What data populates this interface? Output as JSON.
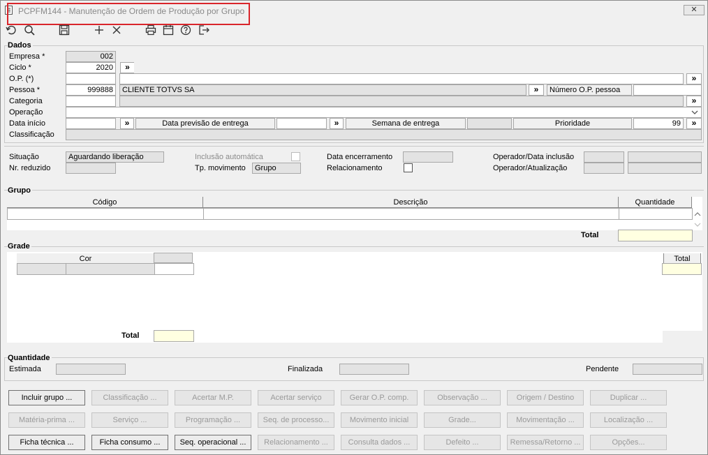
{
  "window": {
    "title": "PCPFM144 - Manutenção de Ordem de Produção por Grupo",
    "close_label": "✕"
  },
  "toolbar": {
    "icons": [
      "undo-icon",
      "search-icon",
      "save-icon",
      "add-icon",
      "delete-icon",
      "print-icon",
      "calendar-icon",
      "help-icon",
      "exit-icon"
    ]
  },
  "dados": {
    "title": "Dados",
    "empresa_label": "Empresa *",
    "empresa_value": "002",
    "ciclo_label": "Ciclo *",
    "ciclo_value": "2020",
    "op_label": "O.P. (*)",
    "op_value": "",
    "pessoa_label": "Pessoa *",
    "pessoa_value": "999888",
    "pessoa_name": "CLIENTE TOTVS SA",
    "numero_op_pessoa_label": "Número O.P. pessoa",
    "numero_op_pessoa_value": "",
    "categoria_label": "Categoria",
    "operacao_label": "Operação",
    "data_inicio_label": "Data início",
    "data_previsao_label": "Data previsão de entrega",
    "semana_label": "Semana de entrega",
    "prioridade_label": "Prioridade",
    "prioridade_value": "99",
    "classificacao_label": "Classificação",
    "search_symbol": "»"
  },
  "status": {
    "situacao_label": "Situação",
    "situacao_value": "Aguardando liberação",
    "nr_reduzido_label": "Nr. reduzido",
    "inclusao_automatica_label": "Inclusão automática",
    "tp_movimento_label": "Tp. movimento",
    "tp_movimento_value": "Grupo",
    "data_encerramento_label": "Data encerramento",
    "relacionamento_label": "Relacionamento",
    "operador_inclusao_label": "Operador/Data inclusão",
    "operador_atualizacao_label": "Operador/Atualização"
  },
  "grupo": {
    "title": "Grupo",
    "columns": [
      "Código",
      "Descrição",
      "Quantidade"
    ],
    "total_label": "Total"
  },
  "grade": {
    "title": "Grade",
    "cor_label": "Cor",
    "total_col_label": "Total",
    "total_label": "Total"
  },
  "quantidade": {
    "title": "Quantidade",
    "estimada_label": "Estimada",
    "finalizada_label": "Finalizada",
    "pendente_label": "Pendente"
  },
  "buttons": {
    "row1": [
      {
        "label": "Incluir grupo ...",
        "enabled": true
      },
      {
        "label": "Classificação ...",
        "enabled": false
      },
      {
        "label": "Acertar M.P.",
        "enabled": false
      },
      {
        "label": "Acertar serviço",
        "enabled": false
      },
      {
        "label": "Gerar O.P. comp.",
        "enabled": false
      },
      {
        "label": "Observação ...",
        "enabled": false
      },
      {
        "label": "Origem / Destino",
        "enabled": false
      },
      {
        "label": "Duplicar ...",
        "enabled": false
      }
    ],
    "row2": [
      {
        "label": "Matéria-prima ...",
        "enabled": false
      },
      {
        "label": "Serviço ...",
        "enabled": false
      },
      {
        "label": "Programação ...",
        "enabled": false
      },
      {
        "label": "Seq. de processo...",
        "enabled": false
      },
      {
        "label": "Movimento inicial",
        "enabled": false
      },
      {
        "label": "Grade...",
        "enabled": false
      },
      {
        "label": "Movimentação ...",
        "enabled": false
      },
      {
        "label": "Localização ...",
        "enabled": false
      }
    ],
    "row3": [
      {
        "label": "Ficha técnica ...",
        "enabled": true
      },
      {
        "label": "Ficha consumo ...",
        "enabled": true
      },
      {
        "label": "Seq. operacional ...",
        "enabled": true
      },
      {
        "label": "Relacionamento ...",
        "enabled": false
      },
      {
        "label": "Consulta dados ...",
        "enabled": false
      },
      {
        "label": "Defeito ...",
        "enabled": false
      },
      {
        "label": "Remessa/Retorno ...",
        "enabled": false
      },
      {
        "label": "Opções...",
        "enabled": false
      }
    ]
  }
}
